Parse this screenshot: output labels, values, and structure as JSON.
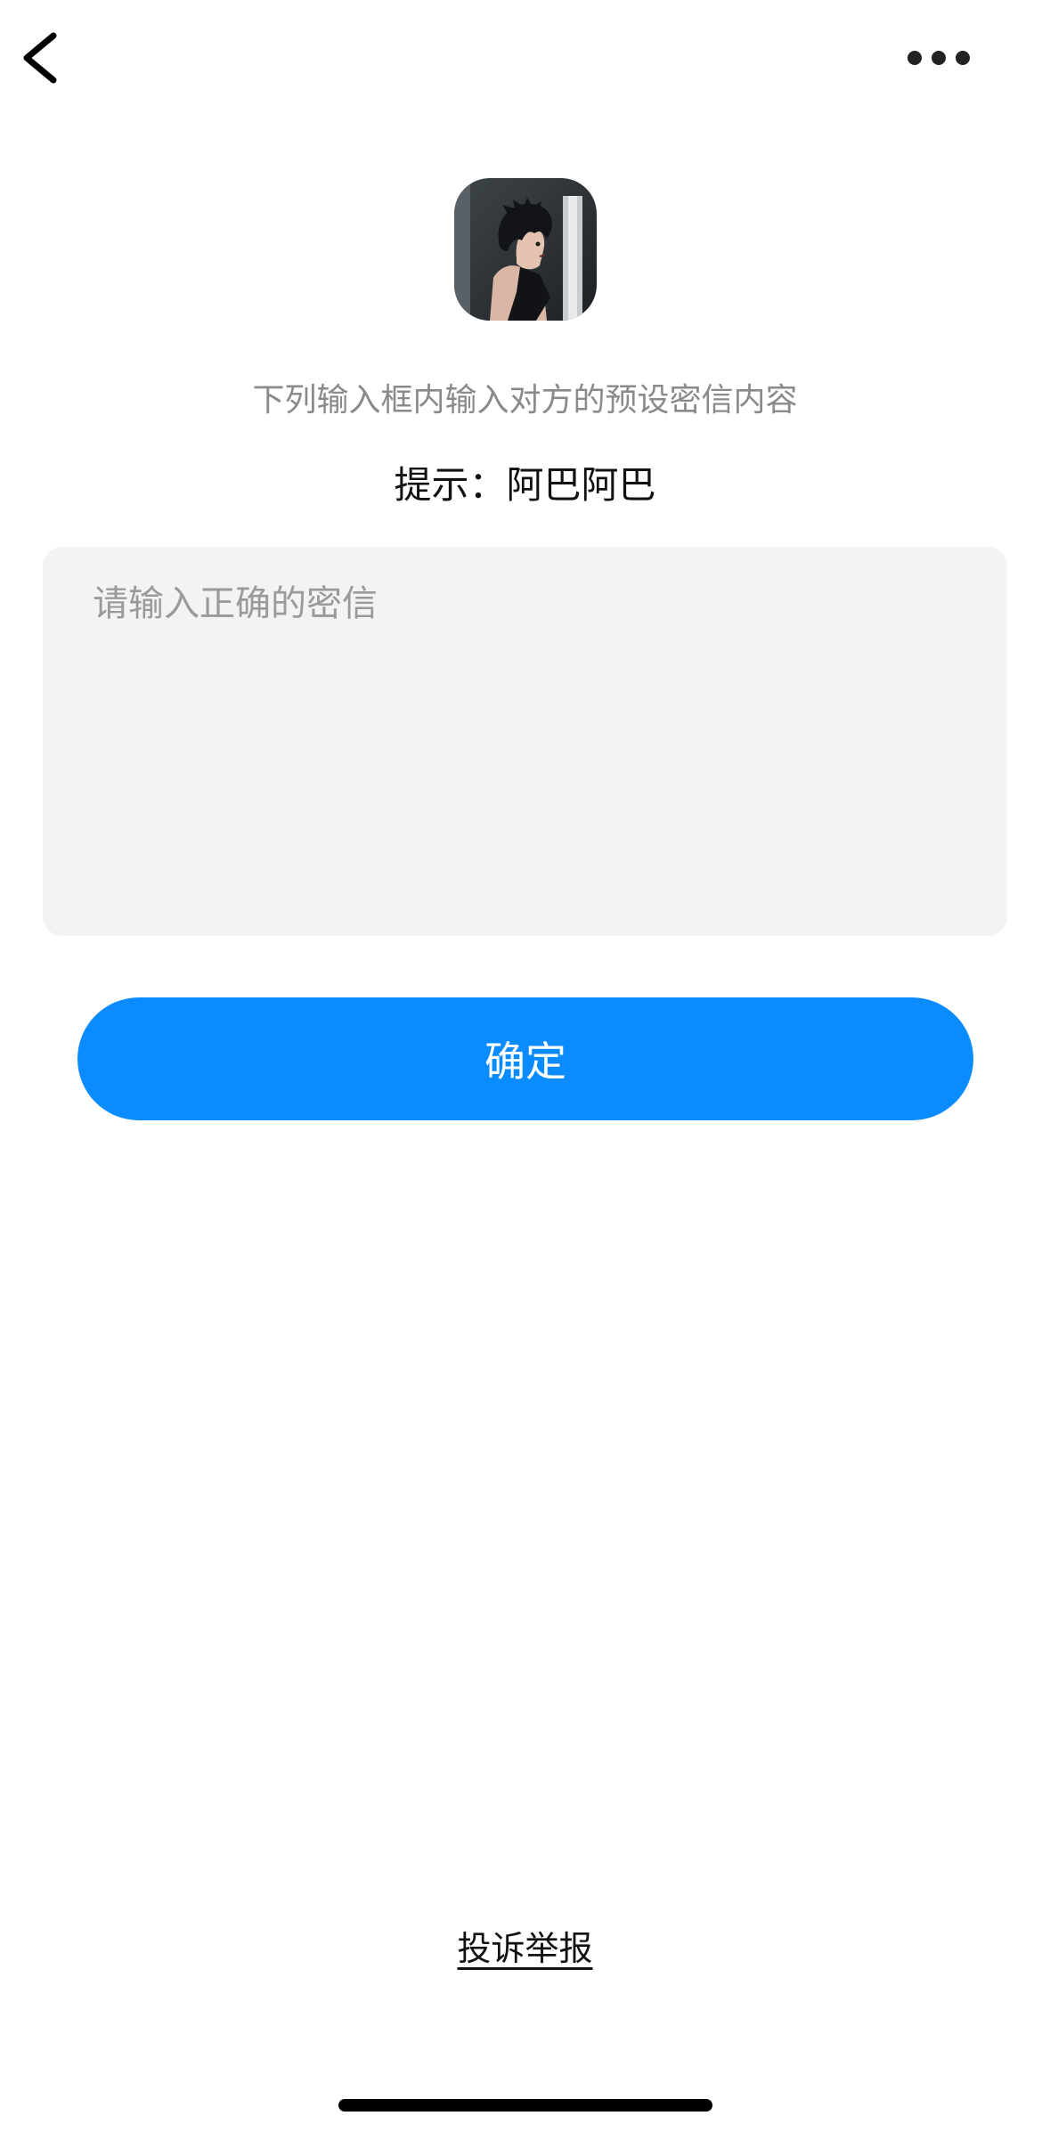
{
  "nav": {
    "back_icon": "chevron-left-icon",
    "more_icon": "more-horizontal-icon"
  },
  "profile": {
    "avatar_description": "anime-style avatar of dark-haired character"
  },
  "instruction": "下列输入框内输入对方的预设密信内容",
  "hint": {
    "label": "提示：",
    "value": "阿巴阿巴"
  },
  "secret_input": {
    "placeholder": "请输入正确的密信",
    "value": ""
  },
  "confirm_button": {
    "label": "确定"
  },
  "report_link": "投诉举报",
  "colors": {
    "accent": "#0a8bff",
    "input_background": "#f3f3f3",
    "instruction_text": "#8a8a8a"
  }
}
